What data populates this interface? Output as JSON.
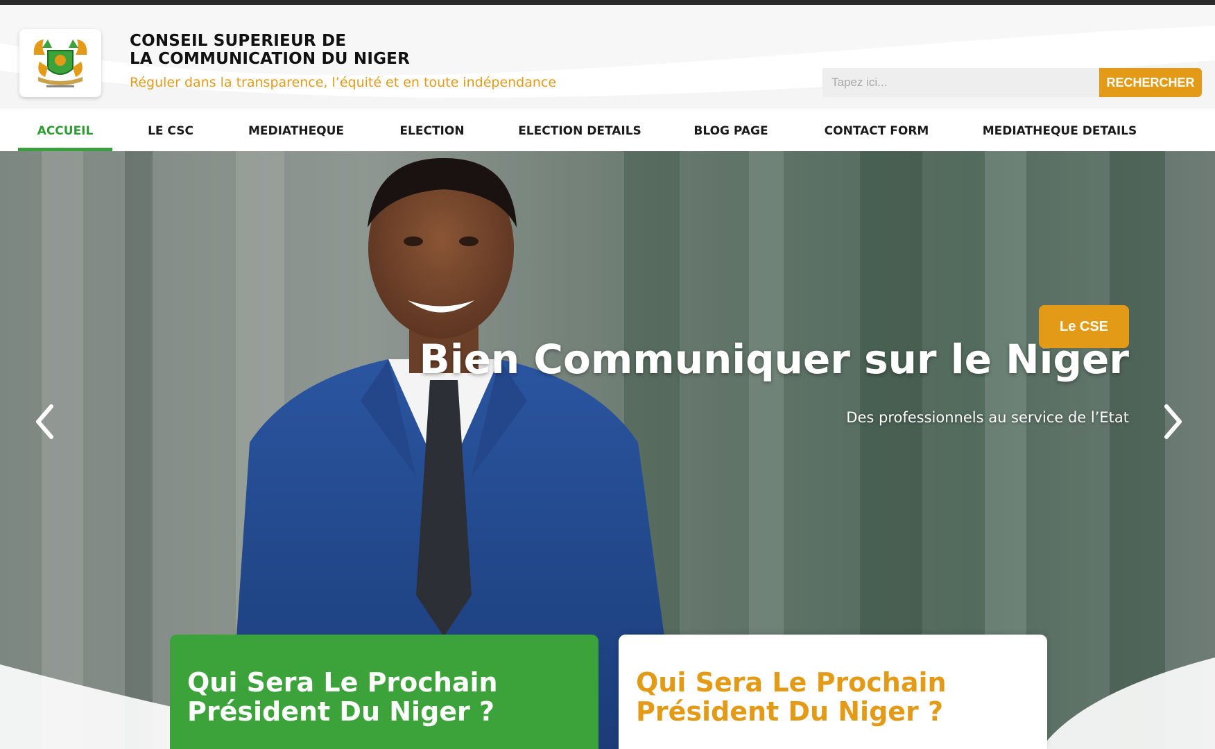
{
  "header": {
    "org_title_line1": "CONSEIL SUPERIEUR DE",
    "org_title_line2": "LA COMMUNICATION DU NIGER",
    "tagline": "Réguler dans la transparence, l’équité et en toute indépendance",
    "logo_icon": "niger-coat-of-arms-logo"
  },
  "search": {
    "placeholder": "Tapez ici...",
    "button_label": "RECHERCHER"
  },
  "nav": {
    "items": [
      {
        "label": "ACCUEIL",
        "active": true
      },
      {
        "label": "LE CSC",
        "active": false
      },
      {
        "label": "MEDIATHEQUE",
        "active": false
      },
      {
        "label": "ELECTION",
        "active": false
      },
      {
        "label": "ELECTION DETAILS",
        "active": false
      },
      {
        "label": "BLOG PAGE",
        "active": false
      },
      {
        "label": "CONTACT FORM",
        "active": false
      },
      {
        "label": "MEDIATHEQUE DETAILS",
        "active": false
      }
    ]
  },
  "hero": {
    "title": "Bien Communiquer sur le Niger",
    "subtitle": "Des professionnels au service de l’Etat",
    "button_label": "Le CSE",
    "prev_icon": "chevron-left-icon",
    "next_icon": "chevron-right-icon"
  },
  "cards": [
    {
      "title_line1": "Qui Sera Le Prochain",
      "title_line2": "Président Du Niger ?"
    },
    {
      "title_line1": "Qui Sera Le Prochain",
      "title_line2": "Président Du Niger ?"
    }
  ],
  "colors": {
    "accent_orange": "#e39b17",
    "accent_green": "#3ca33a",
    "text_dark": "#111111"
  }
}
